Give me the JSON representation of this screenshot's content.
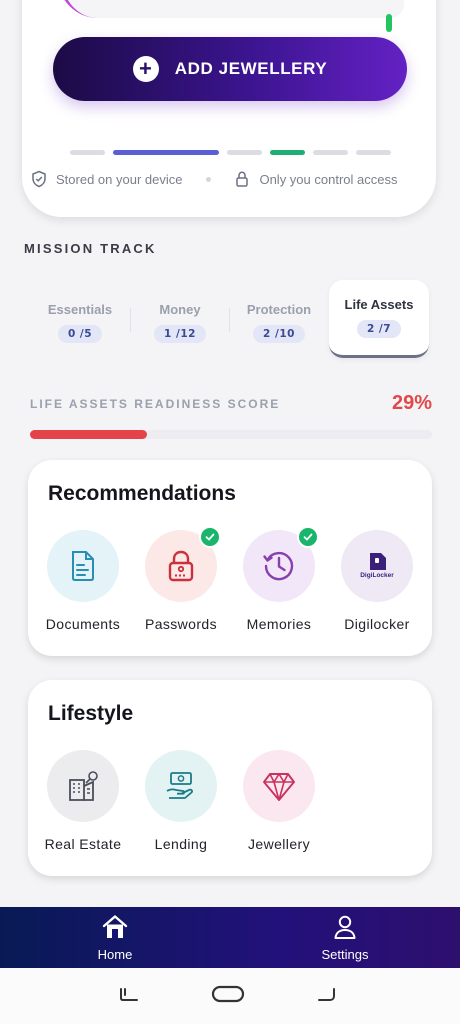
{
  "top_card": {
    "add_button_label": "ADD JEWELLERY",
    "trust_items": [
      {
        "icon": "shield-icon",
        "label": "Stored on your device"
      },
      {
        "icon": "lock-icon",
        "label": "Only you control access"
      }
    ]
  },
  "mission": {
    "title": "MISSION TRACK",
    "tabs": [
      {
        "label": "Essentials",
        "badge": "0 /5",
        "active": false
      },
      {
        "label": "Money",
        "badge": "1 /12",
        "active": false
      },
      {
        "label": "Protection",
        "badge": "2 /10",
        "active": false
      },
      {
        "label": "Life Assets",
        "badge": "2 /7",
        "active": true
      }
    ]
  },
  "score": {
    "label": "LIFE ASSETS READINESS SCORE",
    "value": "29%",
    "fraction": 0.29,
    "color": "#e5434a"
  },
  "recommendations": {
    "title": "Recommendations",
    "items": [
      {
        "label": "Documents",
        "icon": "document-icon",
        "checked": false,
        "bg": "#e3f3f8"
      },
      {
        "label": "Passwords",
        "icon": "padlock-icon",
        "checked": true,
        "bg": "#fde8e8"
      },
      {
        "label": "Memories",
        "icon": "history-clock-icon",
        "checked": true,
        "bg": "#f1e7f8"
      },
      {
        "label": "Digilocker",
        "icon": "digilocker-icon",
        "checked": false,
        "bg": "#eee9f5"
      }
    ]
  },
  "lifestyle": {
    "title": "Lifestyle",
    "items": [
      {
        "label": "Real Estate",
        "icon": "building-icon",
        "bg": "#ececef"
      },
      {
        "label": "Lending",
        "icon": "lending-hand-icon",
        "bg": "#e3f3f3"
      },
      {
        "label": "Jewellery",
        "icon": "gem-icon",
        "bg": "#fbe7f0"
      }
    ]
  },
  "bottom_nav": [
    {
      "label": "Home",
      "icon": "home-icon"
    },
    {
      "label": "Settings",
      "icon": "user-icon"
    }
  ],
  "digilocker_logo_text": "DigiLocker"
}
